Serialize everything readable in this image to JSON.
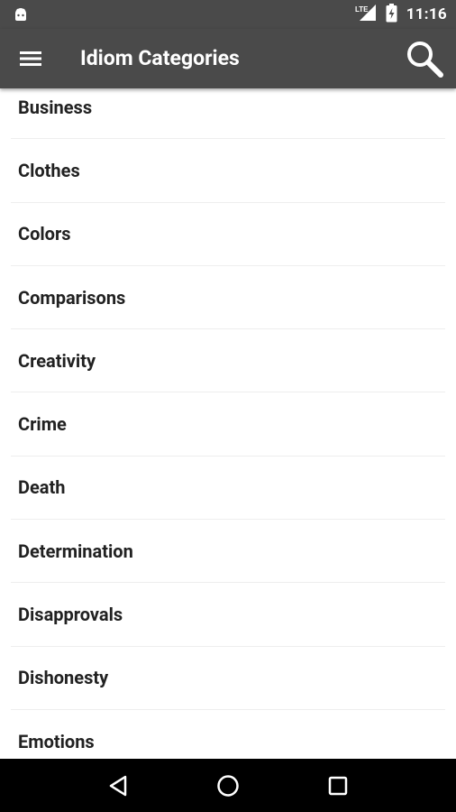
{
  "status_bar": {
    "time": "11:16",
    "icons": [
      "android-icon",
      "lte-signal-icon",
      "battery-charging-icon"
    ]
  },
  "app_bar": {
    "title": "Idiom Categories",
    "menu_icon": "hamburger-menu-icon",
    "search_icon": "search-icon"
  },
  "categories": [
    "Business",
    "Clothes",
    "Colors",
    "Comparisons",
    "Creativity",
    "Crime",
    "Death",
    "Determination",
    "Disapprovals",
    "Dishonesty",
    "Emotions"
  ],
  "nav_bar": {
    "icons": [
      "back-icon",
      "home-icon",
      "recents-icon"
    ]
  },
  "colors": {
    "app_bar": "#4a4a4a",
    "nav_bar": "#000000",
    "text": "#212121",
    "divider": "#eeeeee"
  }
}
